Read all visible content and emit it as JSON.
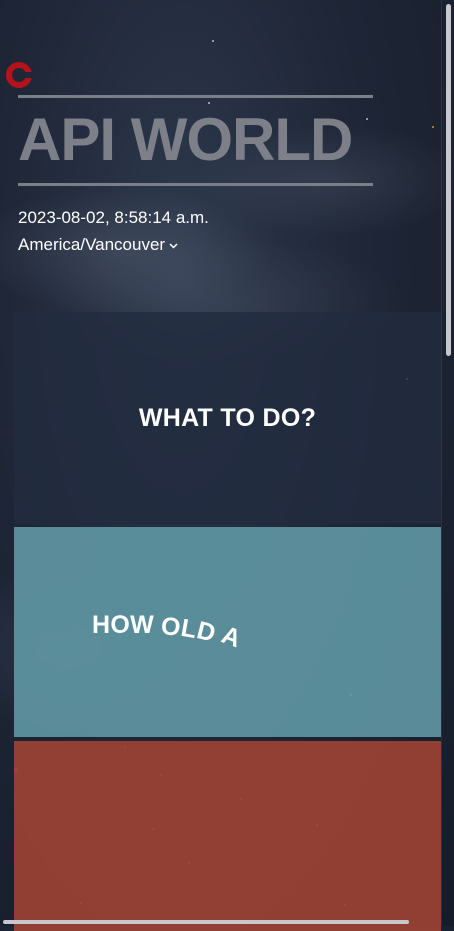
{
  "header": {
    "logo_icon": "red-ring-logo-icon",
    "title": "API WORLD",
    "datetime": "2023-08-02, 8:58:14 a.m.",
    "timezone": "America/Vancouver",
    "timezone_chevron_icon": "chevron-down-icon"
  },
  "cards": [
    {
      "label": "WHAT TO DO?",
      "color": "#222c40"
    },
    {
      "label": "HOW OLD A",
      "color": "#6098a4"
    },
    {
      "label": "",
      "color": "#9c4234"
    }
  ],
  "colors": {
    "accent_logo": "#b3131b",
    "title_gray": "#7d8088",
    "background": "#1f2738"
  }
}
